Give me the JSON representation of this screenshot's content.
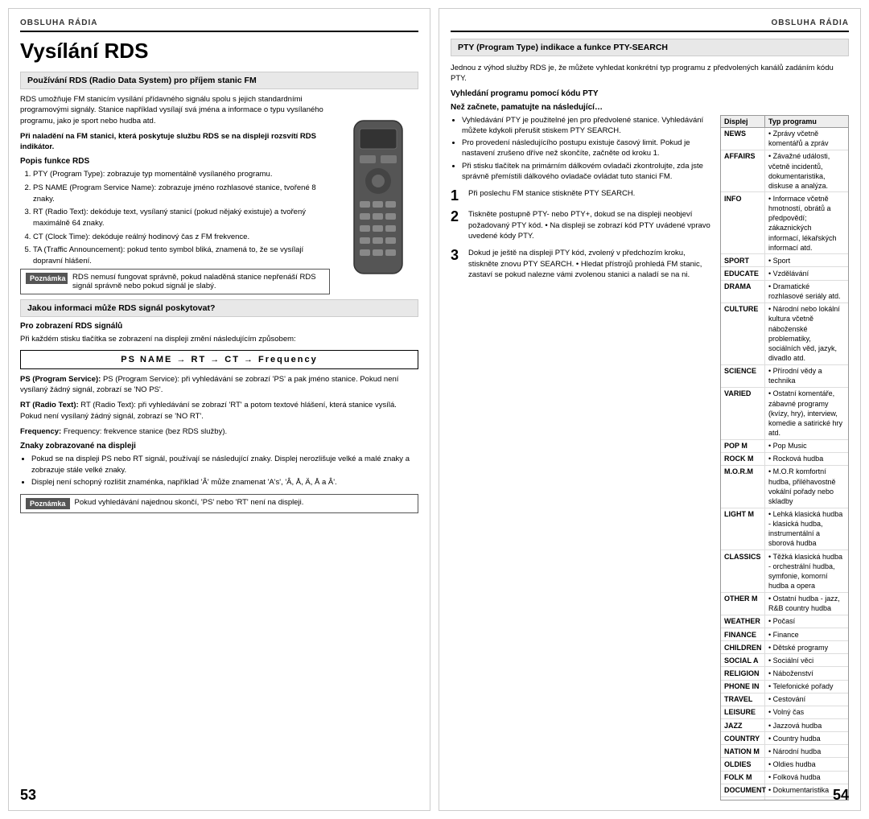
{
  "left_page": {
    "header": "OBSLUHA RÁDIA",
    "title": "Vysílání RDS",
    "section1_title": "Používání RDS (Radio Data System) pro příjem stanic FM",
    "intro_text": "RDS umožňuje FM stanicím vysílání přídavného signálu spolu s jejich standardními programovými signály. Stanice například vysílají svá jména a informace o typu vysílaného programu, jako je sport nebo hudba atd.",
    "highlight_text": "Při naladění na FM stanici, která poskytuje službu RDS se na displeji rozsvítí RDS indikátor.",
    "popis_title": "Popis funkce RDS",
    "numbered_items": [
      "PTY (Program Type): zobrazuje typ momentálně vysílaného programu.",
      "PS NAME (Program Service Name): zobrazuje jméno rozhlasové stanice, tvořené 8 znaky.",
      "RT (Radio Text): dekóduje text, vysílaný stanicí (pokud nějaký existuje) a tvořený maximálně 64 znaky.",
      "CT (Clock Time): dekóduje reálný hodinový čas z FM frekvence.",
      "TA (Traffic Announcement): pokud tento symbol bliká, znamená to, že se vysílají dopravní hlášení."
    ],
    "note1_label": "Poznámka",
    "note1_items": [
      "RDS nemusí fungovat správně, pokud naladěná stanice nepřenáší RDS signál správně nebo pokud signál je slabý."
    ],
    "section2_title": "Jakou informaci může RDS signál poskytovat?",
    "pro_zobrazeni_title": "Pro zobrazení RDS signálů",
    "pro_zobrazeni_text": "Při každém stisku tlačítka se zobrazení na displeji změní následujícím způsobem:",
    "formula": "PS NAME → RT → CT → Frequency",
    "ps_text": "PS (Program Service): při vyhledávání se zobrazí 'PS' a pak jméno stanice. Pokud není vysílaný žádný signál, zobrazí se 'NO PS'.",
    "rt_text": "RT (Radio Text): při vyhledávání se zobrazí 'RT' a potom textové hlášení, která stanice vysílá. Pokud není vysílaný žádný signál, zobrazí se 'NO RT'.",
    "freq_text": "Frequency: frekvence stanice (bez RDS služby).",
    "znaky_title": "Znaky zobrazované na displeji",
    "znaky_bullets": [
      "Pokud se na displeji PS nebo RT signál, používají se následující znaky. Displej nerozlišuje velké a malé znaky a zobrazuje stále velké znaky.",
      "Displej není schopný rozlišit znaménka, například 'Â' může znamenat 'A's', 'Â, Å, Ä, Å a Â'."
    ],
    "note2_label": "Poznámka",
    "note2_text": "Pokud vyhledávání najednou skončí, 'PS' nebo 'RT' není na displeji.",
    "page_number": "53"
  },
  "right_page": {
    "header": "OBSLUHA RÁDIA",
    "pty_section_title": "PTY (Program Type) indikace a funkce PTY-SEARCH",
    "intro_text": "Jednou z výhod služby RDS je, že můžete vyhledat konkrétní typ programu z předvolených kanálů zadáním kódu PTY.",
    "search_title": "Vyhledání programu pomocí kódu PTY",
    "before_start_title": "Než začnete, pamatujte na následující…",
    "before_start_bullets": [
      "Vyhledávání PTY je použitelné jen pro předvolené stanice. Vyhledávání můžete kdykoli přerušit stiskem PTY SEARCH.",
      "Pro provedení následujícího postupu existuje časový limit. Pokud je nastavení zrušeno dříve než skončíte, začněte od kroku 1.",
      "Při stisku tlačítek na primárním dálkovém ovladači zkontrolujte, zda jste správně přemístili dálkového ovladače ovládat tuto stanici FM."
    ],
    "steps": [
      {
        "number": "1",
        "text": "Při poslechu FM stanice stiskněte PTY SEARCH."
      },
      {
        "number": "2",
        "text": "Tiskněte postupně PTY- nebo PTY+, dokud se na displeji neobjeví požadovaný PTY kód.\n• Na displeji se zobrazí kód PTY uvádené vpravo uvedené kódy PTY."
      },
      {
        "number": "3",
        "text": "Dokud je ještě na displeji PTY kód, zvolený v předchozím kroku, stiskněte znovu PTY SEARCH.\n• Hledat přístrojů prohledá FM stanic, zastaví se pokud nalezne vámi zvolenou stanici a naladí se na ni."
      }
    ],
    "table_headers": [
      "Displej",
      "Typ programu"
    ],
    "table_rows": [
      {
        "key": "NEWS",
        "value": "• Zprávy včetně komentářů a zpráv"
      },
      {
        "key": "AFFAIRS",
        "value": "• Závažné události, včetně incidentů, dokumentaristika, diskuse a analýza."
      },
      {
        "key": "INFO",
        "value": "• Informace včetně hmotností, obrátů a předpovědí; zákaznických informací, lékařských informací atd."
      },
      {
        "key": "SPORT",
        "value": "• Sport"
      },
      {
        "key": "EDUCATE",
        "value": "• Vzdělávání"
      },
      {
        "key": "DRAMA",
        "value": "• Dramatické rozhlasové seriály atd."
      },
      {
        "key": "CULTURE",
        "value": "• Národní nebo lokální kultura včetně náboženské problematiky, sociálních věd, jazyk, divadlo atd."
      },
      {
        "key": "SCIENCE",
        "value": "• Přírodní vědy a technika"
      },
      {
        "key": "VARIED",
        "value": "• Ostatní komentáře, zábavné programy (kvízy, hry), interview, komedie a satirické hry atd."
      },
      {
        "key": "POP M",
        "value": "• Pop Music"
      },
      {
        "key": "ROCK M",
        "value": "• Rocková hudba"
      },
      {
        "key": "M.O.R.M",
        "value": "• M.O.R komfortní hudba, přiléhavostně vokální pořady nebo skladby"
      },
      {
        "key": "LIGHT M",
        "value": "• Lehká klasická hudba - klasická hudba, instrumentální a sborová hudba"
      },
      {
        "key": "CLASSICS",
        "value": "• Těžká klasická hudba - orchestrální hudba, symfonie, komorní hudba a opera"
      },
      {
        "key": "OTHER M",
        "value": "• Ostatní hudba - jazz, R&B country hudba"
      },
      {
        "key": "WEATHER",
        "value": "• Počasí"
      },
      {
        "key": "FINANCE",
        "value": "• Finance"
      },
      {
        "key": "CHILDREN",
        "value": "• Dětské programy"
      },
      {
        "key": "SOCIAL A",
        "value": "• Sociální věci"
      },
      {
        "key": "RELIGION",
        "value": "• Náboženství"
      },
      {
        "key": "PHONE IN",
        "value": "• Telefonické pořady"
      },
      {
        "key": "TRAVEL",
        "value": "• Cestování"
      },
      {
        "key": "LEISURE",
        "value": "• Volný čas"
      },
      {
        "key": "JAZZ",
        "value": "• Jazzová hudba"
      },
      {
        "key": "COUNTRY",
        "value": "• Country hudba"
      },
      {
        "key": "NATION M",
        "value": "• Národní hudba"
      },
      {
        "key": "OLDIES",
        "value": "• Oldies hudba"
      },
      {
        "key": "FOLK M",
        "value": "• Folková hudba"
      },
      {
        "key": "DOCUMENT",
        "value": "• Dokumentaristika"
      }
    ],
    "page_number": "54"
  }
}
